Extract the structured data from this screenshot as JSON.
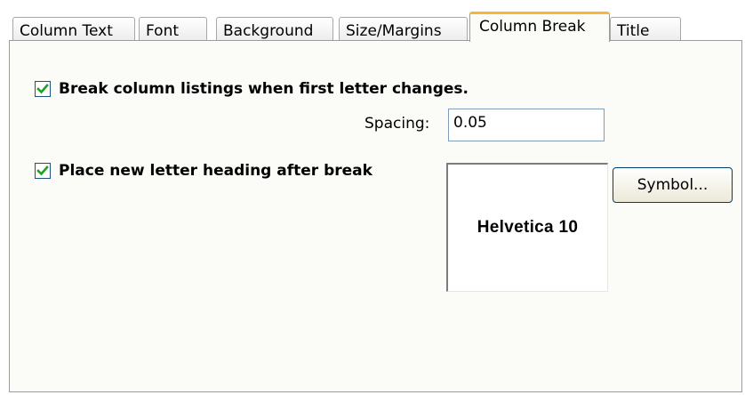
{
  "tabs": [
    {
      "label": "Column Text",
      "active": false
    },
    {
      "label": "Font",
      "active": false
    },
    {
      "label": "Background",
      "active": false
    },
    {
      "label": "Size/Margins",
      "active": false
    },
    {
      "label": "Column Break",
      "active": true
    },
    {
      "label": "Title",
      "active": false
    }
  ],
  "break_option": {
    "label": "Break column listings when first letter changes.",
    "checked": true
  },
  "spacing": {
    "label": "Spacing:",
    "value": "0.05"
  },
  "heading_option": {
    "label": "Place new letter heading after break",
    "checked": true
  },
  "font_preview": {
    "text": "Helvetica 10"
  },
  "symbol_button": {
    "label": "Symbol..."
  },
  "colors": {
    "active_tab_accent": "#f7b733",
    "check_mark": "#21a121",
    "panel_background": "#fbfbf8"
  }
}
